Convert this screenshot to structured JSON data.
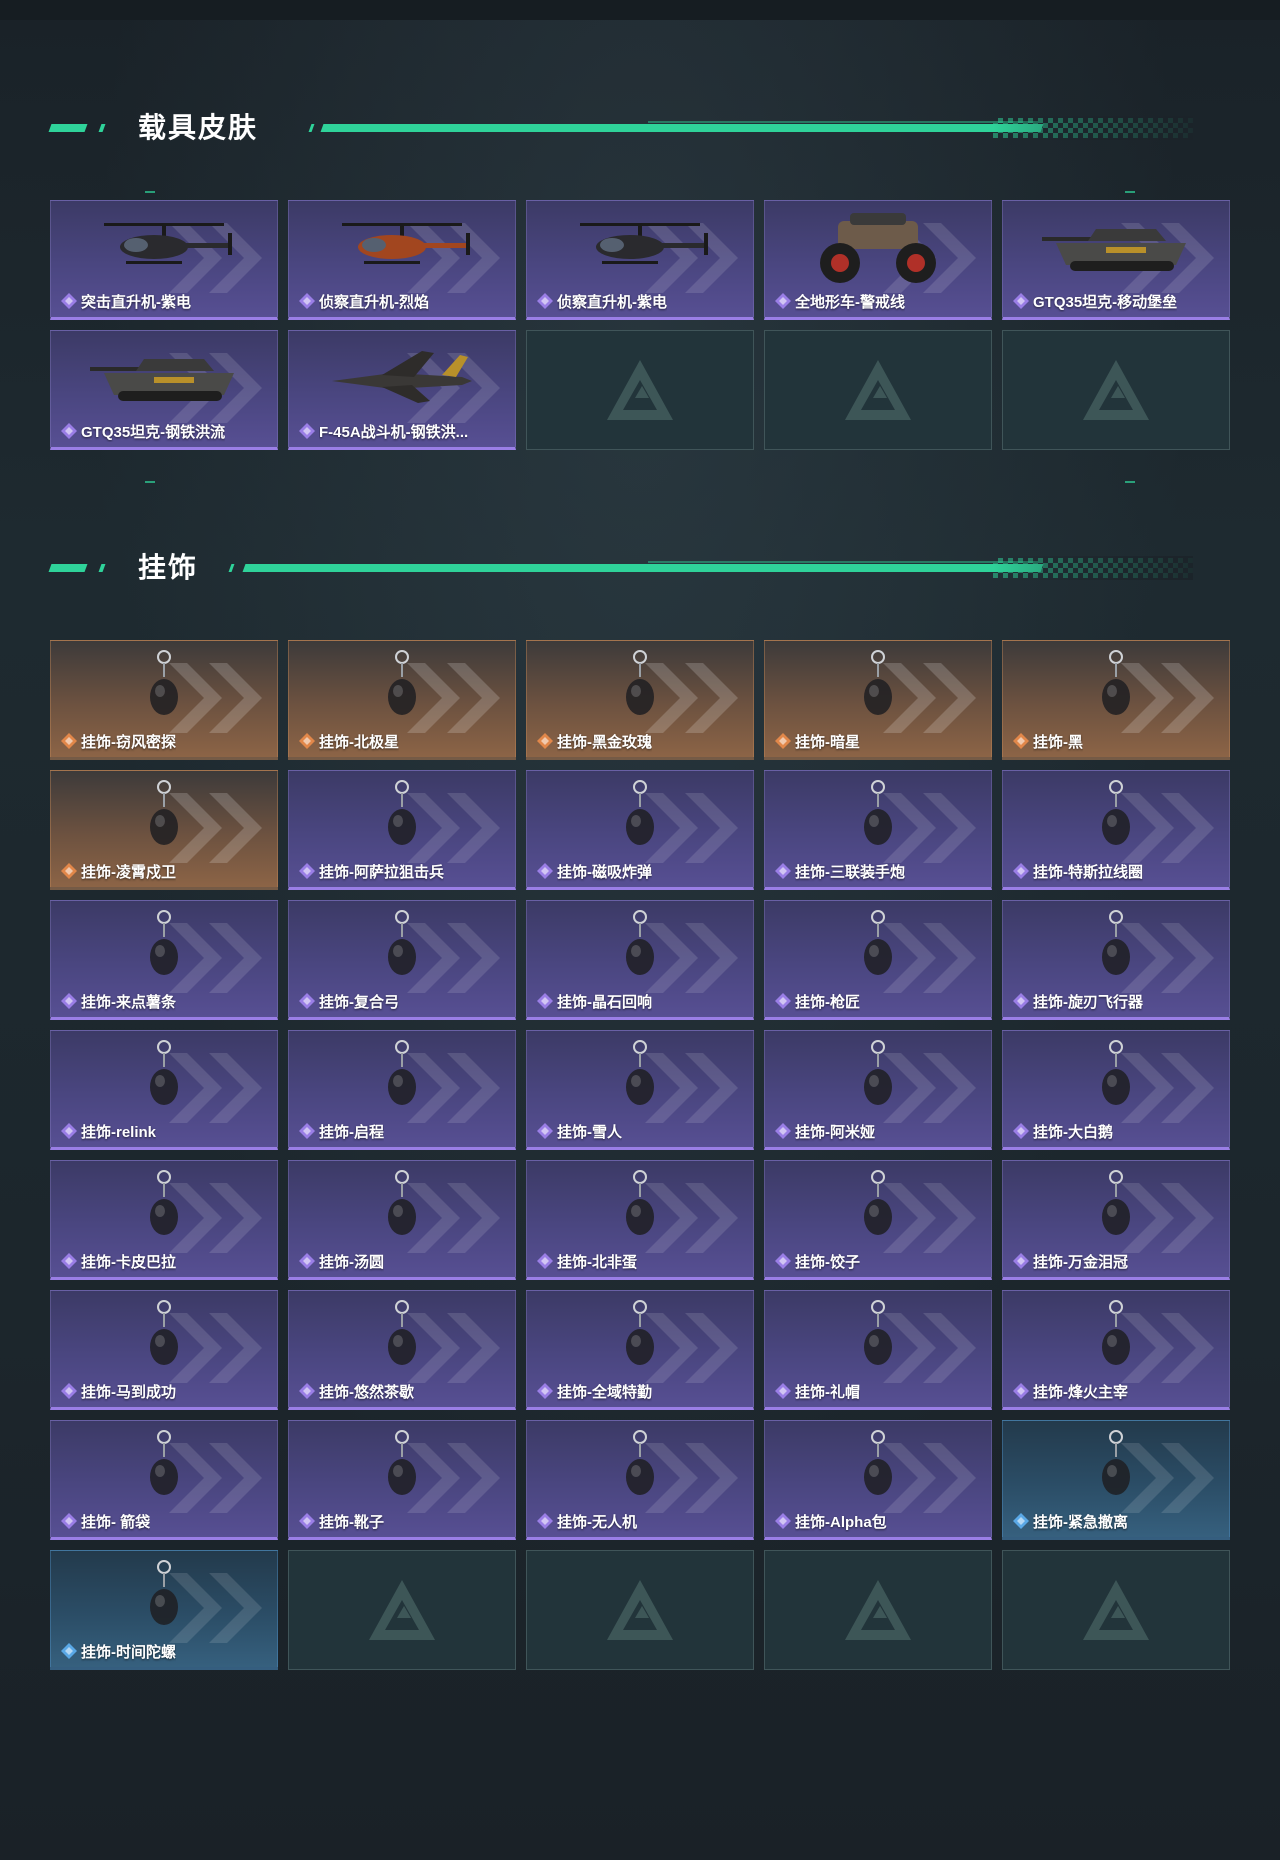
{
  "sections": [
    {
      "title": "载具皮肤",
      "items": [
        {
          "label": "突击直升机-紫电",
          "rarity": "purple",
          "art": "helicopter-attack-icon"
        },
        {
          "label": "侦察直升机-烈焰",
          "rarity": "purple",
          "art": "helicopter-scout-red-icon"
        },
        {
          "label": "侦察直升机-紫电",
          "rarity": "purple",
          "art": "helicopter-scout-black-icon"
        },
        {
          "label": "全地形车-警戒线",
          "rarity": "purple",
          "art": "atv-icon"
        },
        {
          "label": "GTQ35坦克-移动堡垒",
          "rarity": "purple",
          "art": "tank-icon"
        },
        {
          "label": "GTQ35坦克-钢铁洪流",
          "rarity": "purple",
          "art": "tank-icon"
        },
        {
          "label": "F-45A战斗机-钢铁洪...",
          "rarity": "purple",
          "art": "jet-icon"
        },
        {
          "label": "",
          "rarity": "empty"
        },
        {
          "label": "",
          "rarity": "empty"
        },
        {
          "label": "",
          "rarity": "empty"
        }
      ]
    },
    {
      "title": "挂饰",
      "items": [
        {
          "label": "挂饰-窃风密探",
          "rarity": "orange",
          "art": "charm-icon"
        },
        {
          "label": "挂饰-北极星",
          "rarity": "orange",
          "art": "charm-icon"
        },
        {
          "label": "挂饰-黑金玫瑰",
          "rarity": "orange",
          "art": "charm-icon"
        },
        {
          "label": "挂饰-暗星",
          "rarity": "orange",
          "art": "charm-icon"
        },
        {
          "label": "挂饰-黑",
          "rarity": "orange",
          "art": "charm-icon"
        },
        {
          "label": "挂饰-凌霄戍卫",
          "rarity": "orange",
          "art": "charm-icon"
        },
        {
          "label": "挂饰-阿萨拉狙击兵",
          "rarity": "purple",
          "art": "charm-icon"
        },
        {
          "label": "挂饰-磁吸炸弹",
          "rarity": "purple",
          "art": "charm-icon"
        },
        {
          "label": "挂饰-三联装手炮",
          "rarity": "purple",
          "art": "charm-icon"
        },
        {
          "label": "挂饰-特斯拉线圈",
          "rarity": "purple",
          "art": "charm-icon"
        },
        {
          "label": "挂饰-来点薯条",
          "rarity": "purple",
          "art": "charm-icon"
        },
        {
          "label": "挂饰-复合弓",
          "rarity": "purple",
          "art": "charm-icon"
        },
        {
          "label": "挂饰-晶石回响",
          "rarity": "purple",
          "art": "charm-icon"
        },
        {
          "label": "挂饰-枪匠",
          "rarity": "purple",
          "art": "charm-icon"
        },
        {
          "label": "挂饰-旋刃飞行器",
          "rarity": "purple",
          "art": "charm-icon"
        },
        {
          "label": "挂饰-relink",
          "rarity": "purple",
          "art": "charm-icon"
        },
        {
          "label": "挂饰-启程",
          "rarity": "purple",
          "art": "charm-icon"
        },
        {
          "label": "挂饰-雪人",
          "rarity": "purple",
          "art": "charm-icon"
        },
        {
          "label": "挂饰-阿米娅",
          "rarity": "purple",
          "art": "charm-icon"
        },
        {
          "label": "挂饰-大白鹅",
          "rarity": "purple",
          "art": "charm-icon"
        },
        {
          "label": "挂饰-卡皮巴拉",
          "rarity": "purple",
          "art": "charm-icon"
        },
        {
          "label": "挂饰-汤圆",
          "rarity": "purple",
          "art": "charm-icon"
        },
        {
          "label": "挂饰-北非蛋",
          "rarity": "purple",
          "art": "charm-icon"
        },
        {
          "label": "挂饰-饺子",
          "rarity": "purple",
          "art": "charm-icon"
        },
        {
          "label": "挂饰-万金泪冠",
          "rarity": "purple",
          "art": "charm-icon"
        },
        {
          "label": "挂饰-马到成功",
          "rarity": "purple",
          "art": "charm-icon"
        },
        {
          "label": "挂饰-悠然茶歇",
          "rarity": "purple",
          "art": "charm-icon"
        },
        {
          "label": "挂饰-全域特勤",
          "rarity": "purple",
          "art": "charm-icon"
        },
        {
          "label": "挂饰-礼帽",
          "rarity": "purple",
          "art": "charm-icon"
        },
        {
          "label": "挂饰-烽火主宰",
          "rarity": "purple",
          "art": "charm-icon"
        },
        {
          "label": "挂饰- 箭袋",
          "rarity": "purple",
          "art": "charm-icon"
        },
        {
          "label": "挂饰-靴子",
          "rarity": "purple",
          "art": "charm-icon"
        },
        {
          "label": "挂饰-无人机",
          "rarity": "purple",
          "art": "charm-icon"
        },
        {
          "label": "挂饰-Alpha包",
          "rarity": "purple",
          "art": "charm-icon"
        },
        {
          "label": "挂饰-紧急撤离",
          "rarity": "blue",
          "art": "charm-icon"
        },
        {
          "label": "挂饰-时间陀螺",
          "rarity": "blue",
          "art": "charm-icon"
        },
        {
          "label": "",
          "rarity": "empty"
        },
        {
          "label": "",
          "rarity": "empty"
        },
        {
          "label": "",
          "rarity": "empty"
        },
        {
          "label": "",
          "rarity": "empty"
        }
      ]
    }
  ],
  "colors": {
    "accent": "#2fd39a",
    "purple": "#9a7ee6",
    "orange": "#e1874a",
    "blue": "#5aa8e6"
  }
}
